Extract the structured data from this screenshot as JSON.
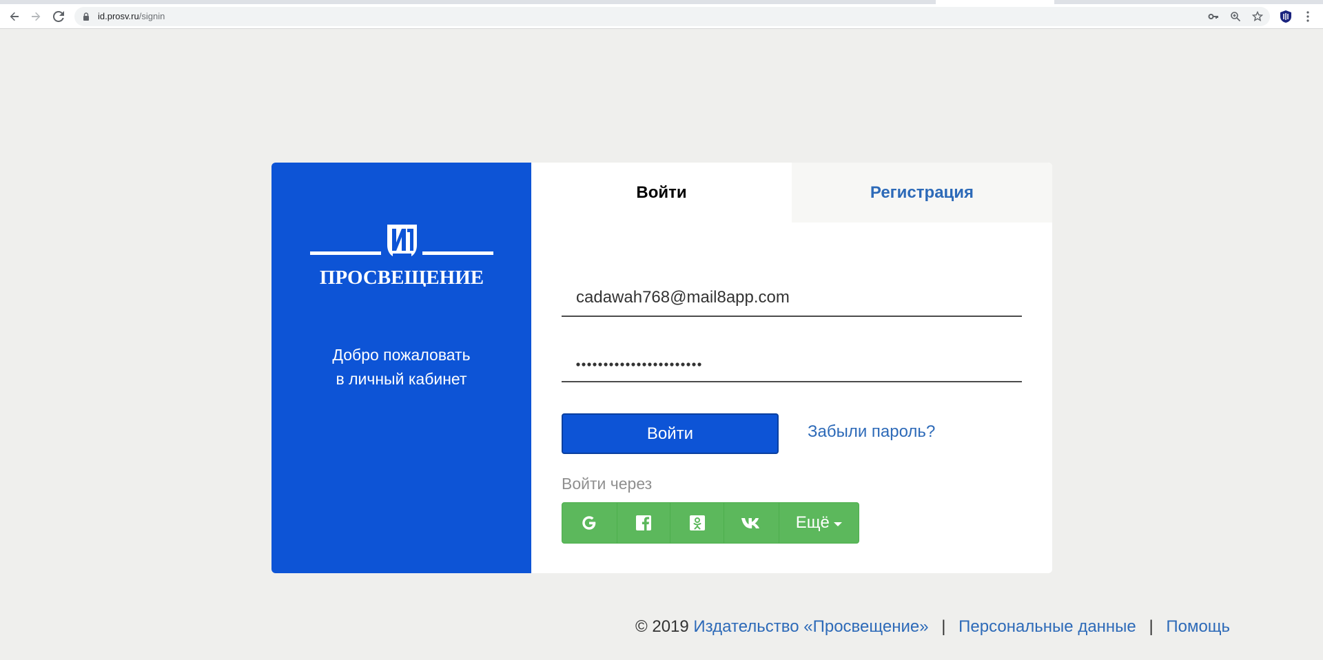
{
  "browser": {
    "url_host": "id.prosv.ru",
    "url_path": "/signin",
    "toolbar_icons": [
      "back-arrow-icon",
      "forward-arrow-icon",
      "reload-icon",
      "lock-icon",
      "key-icon",
      "zoom-icon",
      "star-icon",
      "extension-shield-icon",
      "kebab-menu-icon"
    ]
  },
  "brand": {
    "logo_text": "ПРОСВЕЩЕНИЕ",
    "welcome_line1": "Добро пожаловать",
    "welcome_line2": "в личный кабинет"
  },
  "tabs": {
    "login": "Войти",
    "register": "Регистрация"
  },
  "form": {
    "email_value": "cadawah768@mail8app.com",
    "password_length": 23,
    "submit_label": "Войти",
    "forgot_label": "Забыли пароль?",
    "via_label": "Войти через",
    "social_buttons": [
      "google-icon",
      "facebook-icon",
      "odnoklassniki-icon",
      "vk-icon"
    ],
    "more_label": "Ещё"
  },
  "footer": {
    "copyright": "© 2019",
    "publisher_link": "Издательство «Просвещение»",
    "sep": "|",
    "personal_data_link": "Персональные данные",
    "help_link": "Помощь"
  },
  "colors": {
    "brand_blue": "#0d54d6",
    "link_blue": "#2d6ab8",
    "social_green": "#5cb85c",
    "page_bg": "#efefed"
  }
}
